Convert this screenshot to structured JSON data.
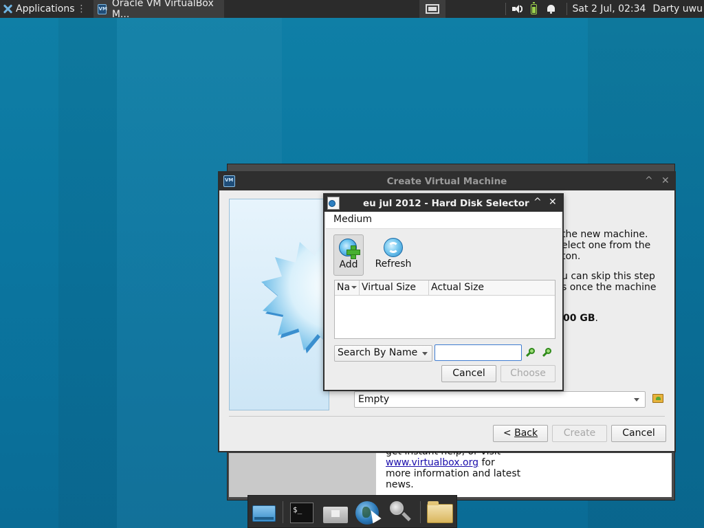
{
  "top_panel": {
    "applications_label": "Applications",
    "applications_suffix": "⋮",
    "task_title": "Oracle VM VirtualBox M...",
    "clock": "Sat  2 Jul, 02:34",
    "user": "Darty uwu"
  },
  "back_window": {
    "line1": "get instant help, or visit",
    "link": "www.virtualbox.org",
    "link_suffix": " for",
    "line3": "more information and latest",
    "line4": "news."
  },
  "wizard": {
    "title": "Create Virtual Machine",
    "minimize": "^",
    "close": "✕",
    "text_p1": [
      "the new machine.",
      "elect one from the",
      "ton."
    ],
    "text_p2": [
      "u can skip this step",
      "s once the machine"
    ],
    "disk_size": "00 GB",
    "disk_size_suffix": ".",
    "disk_combo_value": "Empty",
    "back_prefix": "< ",
    "back_label": "Back",
    "create_label": "Create",
    "cancel_label": "Cancel"
  },
  "hard_disk_selector": {
    "title": "eu jul 2012 - Hard Disk Selector",
    "minimize": "^",
    "close": "✕",
    "menu_medium": "Medium",
    "add_label": "Add",
    "refresh_label": "Refresh",
    "columns": [
      "Na",
      "Virtual Size",
      "Actual Size"
    ],
    "search_mode": "Search By Name",
    "search_value": "",
    "cancel_label": "Cancel",
    "choose_label": "Choose"
  },
  "dock": {
    "terminal_glyph": "$_"
  }
}
